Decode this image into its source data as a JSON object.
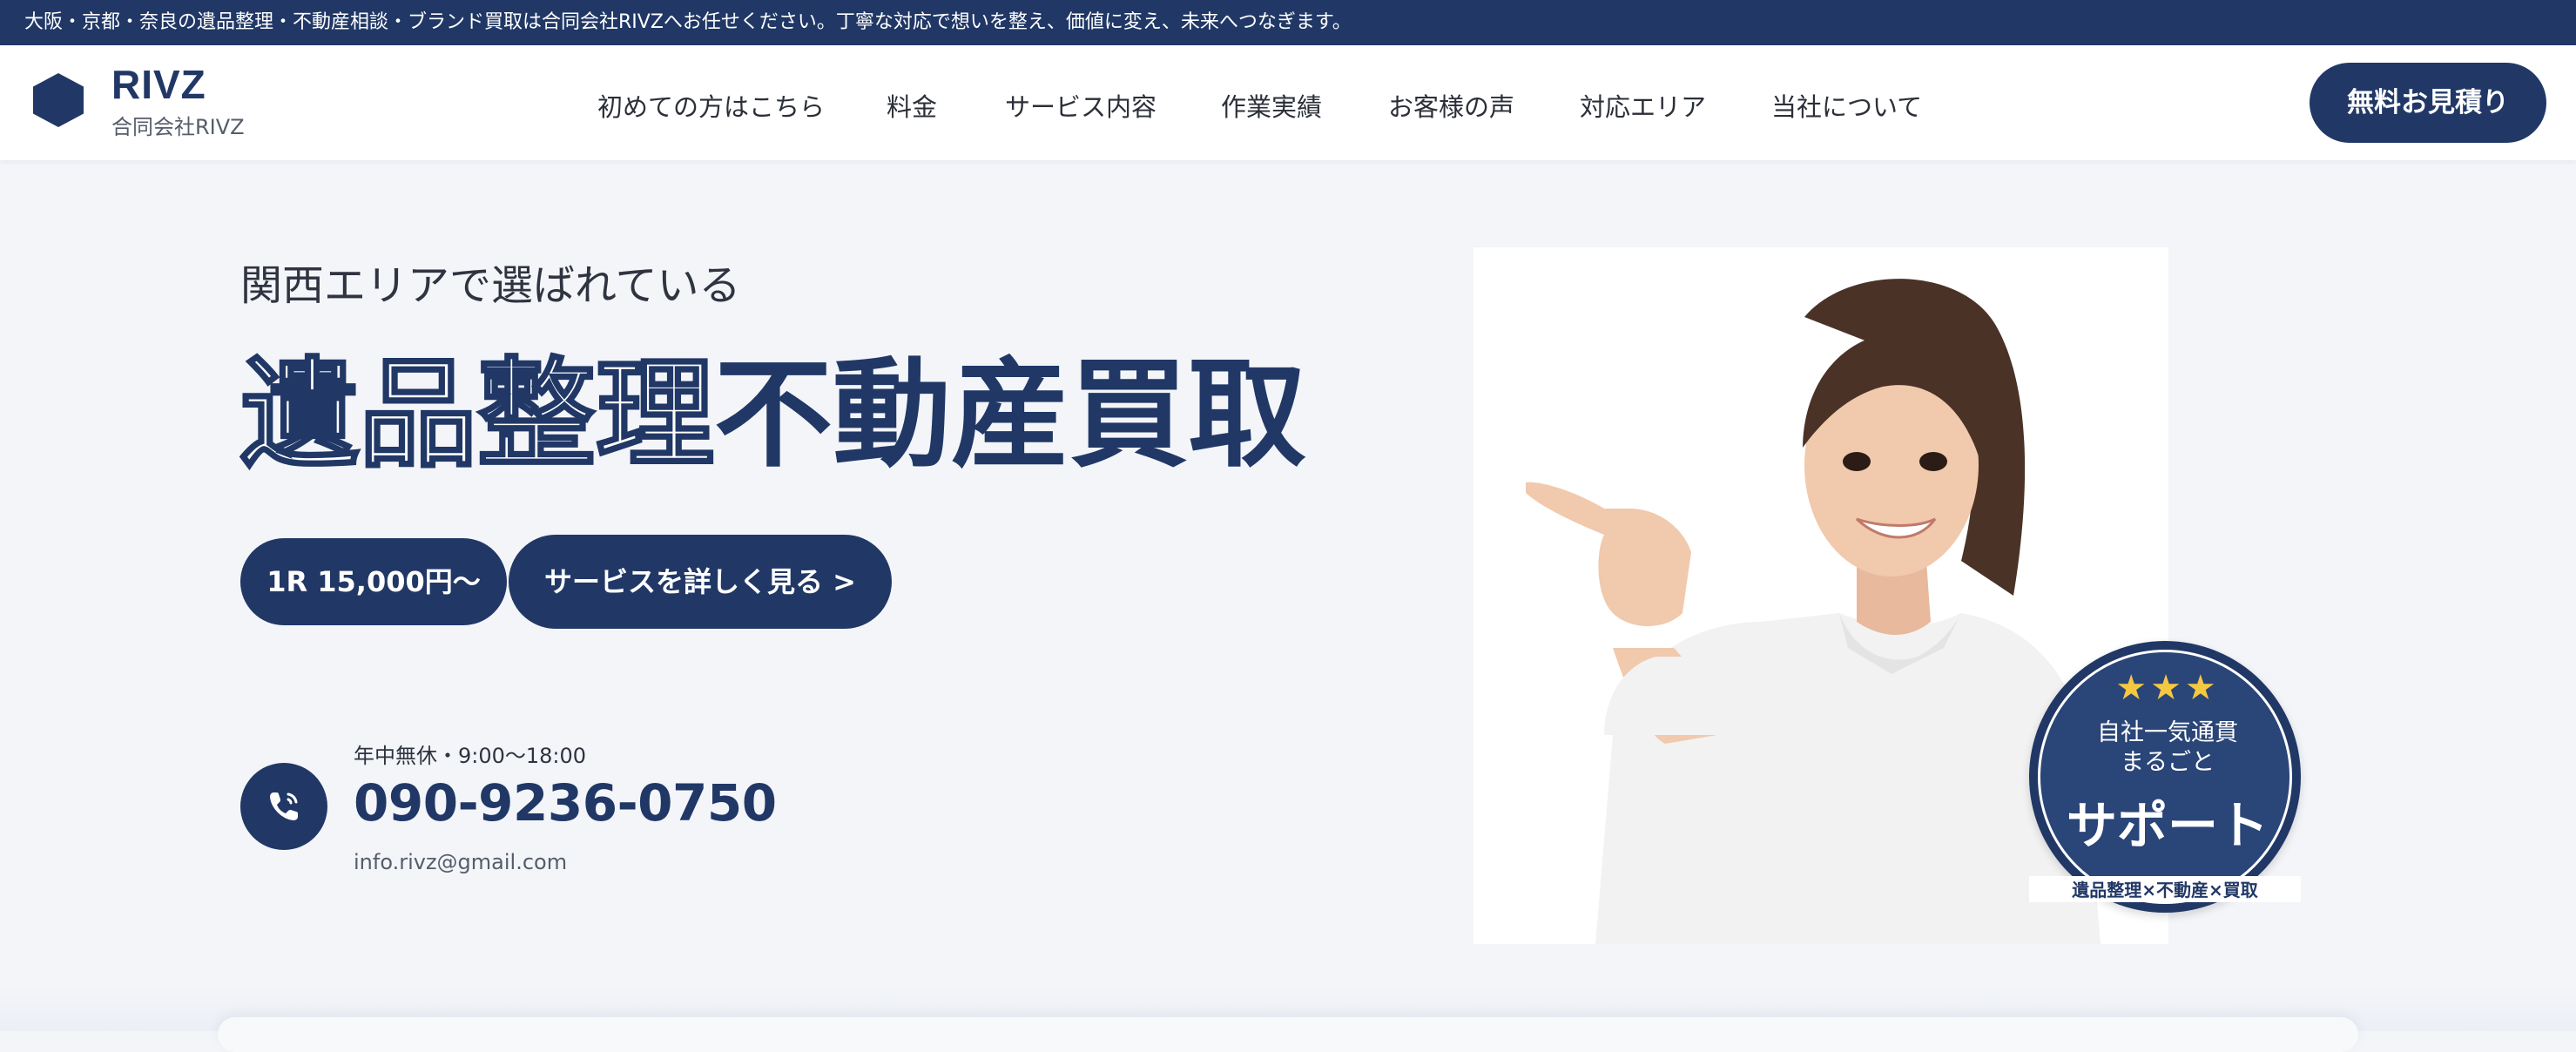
{
  "announcement": "大阪・京都・奈良の遺品整理・不動産相談・ブランド買取は合同会社RIVZへお任せください。丁寧な対応で想いを整え、価値に変え、未来へつなぎます。",
  "brand": {
    "name": "RIVZ",
    "company": "合同会社RIVZ",
    "color": "#213866"
  },
  "nav": {
    "items": [
      "初めての方はこちら",
      "料金",
      "サービス内容",
      "作業実績",
      "お客様の声",
      "対応エリア",
      "当社について"
    ],
    "cta": "無料お見積り"
  },
  "hero": {
    "subtitle": "関西エリアで選ばれている",
    "title_outline": "遺品整理",
    "title_solid": "不動産買取",
    "price_pill": "1R  15,000円〜",
    "service_button": "サービスを詳しく見る  >"
  },
  "contact": {
    "hours": "年中無休・9:00〜18:00",
    "phone": "090-9236-0750",
    "email": "info.rivz@gmail.com",
    "icon": "phone-icon"
  },
  "badge": {
    "stars": "★★★",
    "line1": "自社一気通貫",
    "line2": "まるごと",
    "big": "サポート",
    "caption": "遺品整理×不動産×買取",
    "star_color": "#f5c842"
  }
}
